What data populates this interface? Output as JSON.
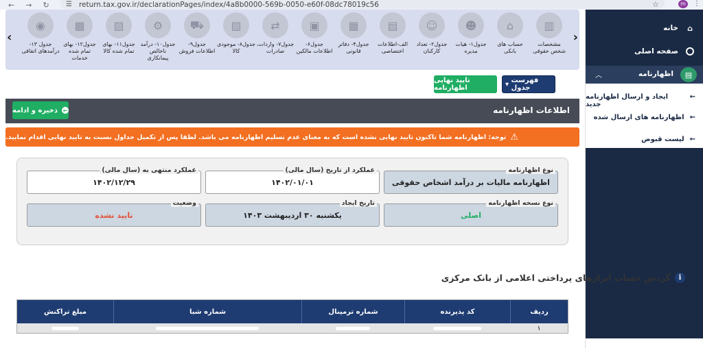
{
  "browser": {
    "url": "return.tax.gov.ir/declarationPages/index/4a8b0000-569b-0050-e60f-08dc78019c56",
    "avatar": "m"
  },
  "sidebar": {
    "home": "خانه",
    "main_page": "صفحه اصلی",
    "declarations": "اظهارنامه",
    "sub_items": [
      "ایجاد و ارسال اظهارنامه جدید",
      "اظهارنامه های ارسال شده",
      "لیست قبوض"
    ]
  },
  "carousel": {
    "items": [
      "مشخصات شخص حقوقی",
      "حساب های بانکی",
      "جدول۱- هیات مدیره",
      "جدول۲- تعداد کارکنان",
      "الف-اطلاعات اختصاصی",
      "جدول۴- دفاتر قانونی",
      "جدول۶- اطلاعات مالکین",
      "جدول۷- واردات، صادرات",
      "جدول۸- موجودی کالا",
      "جدول۹- اطلاعات فروش",
      "جدول۱۰- درآمد ناخالص پیمانکاری",
      "جدول۱۱- بهای تمام شده کالا",
      "جدول۱۲- بهای تمام شده خدمات",
      "جدول ۱۳- درآمدهای اتفاقی"
    ]
  },
  "buttons": {
    "list": "فهرست جدول",
    "confirm": "تایید نهایی اظهارنامه",
    "save": "ذخیره و ادامه"
  },
  "header": {
    "title": "اطلاعات اظهارنامه"
  },
  "warning": "توجه: اظهارنامه شما تاکنون تایید نهایی نشده است که به معنای عدم تسلیم اظهارنامه می باشد. لطفا پس از تکمیل جداول نسبت به تایید نهایی اقدام نمایید.",
  "form": {
    "type_label": "نوع اظهارنامه",
    "type_value": "اظهارنامه مالیات بر درآمد اشخاص حقوقی",
    "from_label": "عملکرد از تاریخ (سال مالی)",
    "from_value": "۱۴۰۲/۰۱/۰۱",
    "to_label": "عملکرد منتهی به (سال مالی)",
    "to_value": "۱۴۰۲/۱۲/۲۹",
    "copy_label": "نوع نسخه اظهارنامه",
    "copy_value": "اصلی",
    "created_label": "تاریخ ایجاد",
    "created_value": "یکشنبه ۳۰ اردیبهشت ۱۴۰۳",
    "status_label": "وضعیت",
    "status_value": "تایید نشده"
  },
  "section": {
    "title": "گردش حساب ابزارهای پرداختی اعلامی از بانک مرکزی"
  },
  "table": {
    "headers": [
      "ردیف",
      "کد پذیرنده",
      "شماره ترمینال",
      "شماره شبا",
      "مبلغ تراکنش"
    ],
    "rows": [
      [
        "۱",
        "",
        "",
        "",
        ""
      ]
    ]
  }
}
